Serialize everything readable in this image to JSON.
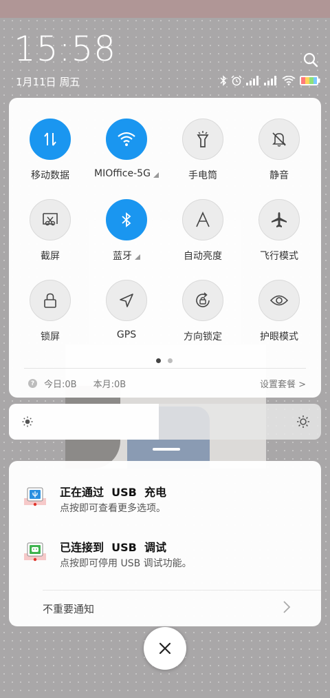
{
  "lockscreen": {
    "time": "15:58",
    "date": "1月11日 周五"
  },
  "status_bar": {
    "icons": [
      "bluetooth-icon",
      "alarm-icon",
      "signal-icon",
      "signal-icon",
      "wifi-icon",
      "battery-icon"
    ]
  },
  "quick_settings": {
    "tiles": [
      {
        "label": "移动数据",
        "icon": "mobile-data-icon",
        "active": true
      },
      {
        "label": "MIOffice-5G",
        "icon": "wifi-icon",
        "active": true,
        "expandable": true
      },
      {
        "label": "手电筒",
        "icon": "flashlight-icon",
        "active": false
      },
      {
        "label": "静音",
        "icon": "bell-off-icon",
        "active": false
      },
      {
        "label": "截屏",
        "icon": "screenshot-icon",
        "active": false
      },
      {
        "label": "蓝牙",
        "icon": "bluetooth-icon",
        "active": true,
        "expandable": true
      },
      {
        "label": "自动亮度",
        "icon": "auto-brightness-icon",
        "active": false
      },
      {
        "label": "飞行模式",
        "icon": "airplane-icon",
        "active": false
      },
      {
        "label": "锁屏",
        "icon": "lock-icon",
        "active": false
      },
      {
        "label": "GPS",
        "icon": "location-icon",
        "active": false
      },
      {
        "label": "方向锁定",
        "icon": "rotation-lock-icon",
        "active": false
      },
      {
        "label": "护眼模式",
        "icon": "eye-icon",
        "active": false
      }
    ],
    "page_indicator": {
      "pages": 2,
      "current": 1
    },
    "data_usage": {
      "today": "今日:0B",
      "month": "本月:0B",
      "settings_link": "设置套餐 >"
    }
  },
  "brightness": {
    "level": 0.48
  },
  "notifications": {
    "items": [
      {
        "title": "正在通过  USB  充电",
        "subtitle": "点按即可查看更多选项。",
        "icon": "usb-icon"
      },
      {
        "title": "已连接到  USB  调试",
        "subtitle": "点按即可停用 USB 调试功能。",
        "icon": "android-debug-icon"
      }
    ],
    "minor_label": "不重要通知"
  },
  "colors": {
    "accent": "#1a96f0",
    "top_band": "#b09696"
  }
}
